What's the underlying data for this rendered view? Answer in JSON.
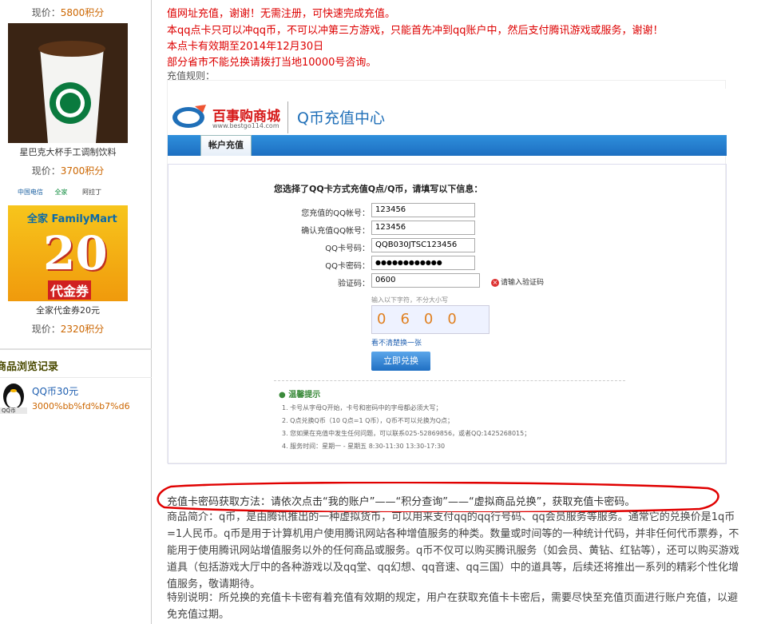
{
  "sidebar": {
    "items": [
      {
        "price_label": "现价：",
        "price_value": "5800积分"
      },
      {
        "name": "星巴克大杯手工调制饮料",
        "price_label": "现价：",
        "price_value": "3700积分"
      },
      {
        "name": "全家代金券20元",
        "price_label": "现价：",
        "price_value": "2320积分",
        "logos": [
          "中国电信",
          "全家",
          "阿拉丁"
        ],
        "card_text": {
          "brand": "全家 FamilyMart",
          "amount": "20",
          "label": "代金券"
        }
      }
    ],
    "history": {
      "title": "商品浏览记录",
      "items": [
        {
          "name": "QQ币30元",
          "price": "3000%bb%fd%b7%d6",
          "icon_label": "QQ币"
        }
      ]
    }
  },
  "notice": {
    "lines": [
      "值网址充值，谢谢！无需注册，可快速完成充值。",
      "本qq点卡只可以冲qq币，不可以冲第三方游戏，只能首先冲到qq账户中，然后支付腾讯游戏或服务，谢谢！",
      "本点卡有效期至2014年12月30日",
      "部分省市不能兑换请拨打当地10000号咨询。"
    ],
    "rules_label": "充值规则："
  },
  "rules_image": {
    "logo_text": "百事购商城",
    "logo_url": "www.bestgo114.com",
    "center_title": "Q币充值中心",
    "tab": "帐户充值",
    "form_title": "您选择了QQ卡方式充值Q点/Q币，请填写以下信息：",
    "fields": [
      {
        "label": "您充值的QQ帐号：",
        "value": "123456"
      },
      {
        "label": "确认充值QQ帐号：",
        "value": "123456"
      },
      {
        "label": "QQ卡号码：",
        "value": "QQB030JTSC123456"
      },
      {
        "label": "QQ卡密码：",
        "value": "●●●●●●●●●●●●"
      },
      {
        "label": "验证码：",
        "value": "0600"
      }
    ],
    "captcha_hint": "请输入验证码",
    "captcha_label": "输入以下字符，不分大小写",
    "captcha_text": "0600",
    "refresh_link": "看不清楚换一张",
    "submit": "立即兑换",
    "tips_title": "温馨提示",
    "tips": [
      "1.  卡号从字母Q开始，卡号和密码中的字母都必须大写；",
      "2.  Q点兑换Q币（10 Q点=1 Q币），Q币不可以兑换为Q点；",
      "3.  您如果在充值中发生任何问题，可以联系025-52869856，或者QQ:1425268015；",
      "4.  服务时间：星期一 - 星期五 8:30-11:30 13:30-17:30"
    ]
  },
  "howto": "充值卡密码获取方法：请依次点击“我的账户”——“积分查询”——“虚拟商品兑换”，获取充值卡密码。",
  "intro": "商品简介：q币，是由腾讯推出的一种虚拟货币，可以用来支付qq的qq行号码、qq会员服务等服务。通常它的兑换价是1q币=1人民币。q币是用于计算机用户使用腾讯网站各种增值服务的种类。数量或时间等的一种统计代码，并非任何代币票券，不能用于使用腾讯网站增值服务以外的任何商品或服务。q币不仅可以购买腾讯服务（如会员、黄钻、红钻等），还可以购买游戏道具（包括游戏大厅中的各种游戏以及qq堂、qq幻想、qq音速、qq三国）中的道具等，后续还将推出一系列的精彩个性化增值服务，敬请期待。",
  "special": "特别说明：所兑换的充值卡卡密有着充值有效期的规定，用户在获取充值卡卡密后，需要尽快至充值页面进行账户充值，以避免充值过期。",
  "colors": {
    "notice_red": "#dd0000",
    "price": "#cc6600",
    "accent_blue": "#1f6fb8",
    "oval": "#e00000"
  }
}
